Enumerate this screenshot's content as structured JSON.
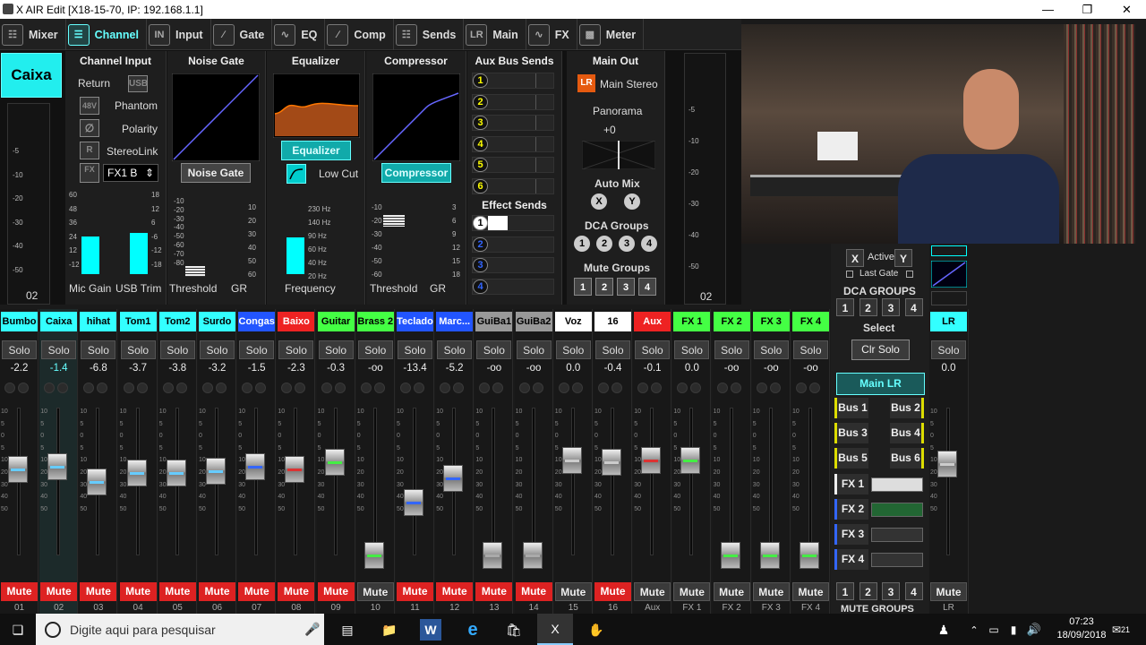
{
  "window": {
    "title": "X AIR Edit [X18-15-70, IP: 192.168.1.1]"
  },
  "nav": {
    "tabs": [
      {
        "label": "Mixer",
        "icon": "mixer-icon"
      },
      {
        "label": "Channel",
        "icon": "channel-icon"
      },
      {
        "label": "Input",
        "icon": "input-icon"
      },
      {
        "label": "Gate",
        "icon": "gate-icon"
      },
      {
        "label": "EQ",
        "icon": "eq-icon"
      },
      {
        "label": "Comp",
        "icon": "comp-icon"
      },
      {
        "label": "Sends",
        "icon": "sends-icon"
      },
      {
        "label": "Main",
        "icon": "main-icon"
      },
      {
        "label": "FX",
        "icon": "fx-icon"
      },
      {
        "label": "Meter",
        "icon": "meter-icon"
      }
    ],
    "active": "Channel"
  },
  "channel": {
    "name": "Caixa",
    "number": "02",
    "input": {
      "title": "Channel Input",
      "return_label": "Return",
      "usb": "USB",
      "phantom_btn": "48V",
      "phantom": "Phantom",
      "polarity": "Polarity",
      "stereolink_btn": "R",
      "stereolink": "StereoLink",
      "fx_btn": "FX",
      "fx_value": "FX1 B",
      "mic_gain": "Mic Gain",
      "usb_trim": "USB Trim",
      "mic_ticks": [
        "60",
        "48",
        "36",
        "24",
        "12",
        "-12"
      ],
      "usb_ticks": [
        "18",
        "12",
        "6",
        "-6",
        "-12",
        "-18"
      ]
    },
    "gate": {
      "title": "Noise Gate",
      "button": "Noise Gate",
      "threshold": "Threshold",
      "gr": "GR",
      "th_ticks": [
        "-10",
        "-20",
        "-30",
        "-40",
        "-50",
        "-60",
        "-70",
        "-80"
      ],
      "gr_ticks": [
        "10",
        "20",
        "30",
        "40",
        "50",
        "60"
      ]
    },
    "eq": {
      "title": "Equalizer",
      "button": "Equalizer",
      "lowcut": "Low Cut",
      "frequency": "Frequency",
      "freq_ticks": [
        "230 Hz",
        "140 Hz",
        "90 Hz",
        "60 Hz",
        "40 Hz",
        "20 Hz"
      ]
    },
    "comp": {
      "title": "Compressor",
      "button": "Compressor",
      "threshold": "Threshold",
      "gr": "GR",
      "th_ticks": [
        "-10",
        "-20",
        "-30",
        "-40",
        "-50",
        "-60"
      ],
      "gr_ticks": [
        "3",
        "6",
        "9",
        "12",
        "15",
        "18"
      ]
    },
    "aux": {
      "title": "Aux Bus Sends",
      "buses": [
        "1",
        "2",
        "3",
        "4",
        "5",
        "6"
      ],
      "effect_title": "Effect Sends",
      "effects": [
        "1",
        "2",
        "3",
        "4"
      ]
    },
    "main": {
      "title": "Main Out",
      "lr": "LR",
      "main_stereo": "Main Stereo",
      "panorama": "Panorama",
      "pan_value": "+0",
      "automix": "Auto Mix",
      "automix_x": "X",
      "automix_y": "Y",
      "dca_title": "DCA Groups",
      "dca": [
        "1",
        "2",
        "3",
        "4"
      ],
      "mute_title": "Mute Groups",
      "mute": [
        "1",
        "2",
        "3",
        "4"
      ]
    },
    "meter_left": {
      "num": "02",
      "ticks": [
        "-5",
        "-10",
        "-20",
        "-30",
        "-40",
        "-50"
      ]
    },
    "meter_right": {
      "num": "02",
      "ticks": [
        "-5",
        "-10",
        "-20",
        "-30",
        "-40",
        "-50"
      ]
    }
  },
  "strips": [
    {
      "name": "Bumbo",
      "color": "#3ff",
      "val": "-2.2",
      "num": "01",
      "mute": "Mute",
      "muted": true,
      "fader": 0.58,
      "stripe": "#6cf"
    },
    {
      "name": "Caixa",
      "color": "#3ff",
      "val": "-1.4",
      "num": "02",
      "mute": "Mute",
      "muted": true,
      "fader": 0.6,
      "stripe": "#6cf"
    },
    {
      "name": "hihat",
      "color": "#3ff",
      "val": "-6.8",
      "num": "03",
      "mute": "Mute",
      "muted": true,
      "fader": 0.5,
      "stripe": "#6cf"
    },
    {
      "name": "Tom1",
      "color": "#3ff",
      "val": "-3.7",
      "num": "04",
      "mute": "Mute",
      "muted": true,
      "fader": 0.56,
      "stripe": "#6cf"
    },
    {
      "name": "Tom2",
      "color": "#3ff",
      "val": "-3.8",
      "num": "05",
      "mute": "Mute",
      "muted": true,
      "fader": 0.56,
      "stripe": "#6cf"
    },
    {
      "name": "Surdo",
      "color": "#3ff",
      "val": "-3.2",
      "num": "06",
      "mute": "Mute",
      "muted": true,
      "fader": 0.57,
      "stripe": "#6cf"
    },
    {
      "name": "Congas",
      "color": "#25f",
      "val": "-1.5",
      "num": "07",
      "mute": "Mute",
      "muted": true,
      "fader": 0.6,
      "stripe": "#36f"
    },
    {
      "name": "Baixo",
      "color": "#e22",
      "val": "-2.3",
      "num": "08",
      "mute": "Mute",
      "muted": true,
      "fader": 0.58,
      "stripe": "#d33"
    },
    {
      "name": "Guitar",
      "color": "#4f4",
      "val": "-0.3",
      "num": "09",
      "mute": "Mute",
      "muted": true,
      "fader": 0.63,
      "stripe": "#4e4"
    },
    {
      "name": "Brass 2",
      "color": "#4f4",
      "val": "-oo",
      "num": "10",
      "mute": "Mute",
      "muted": false,
      "fader": 0.0,
      "stripe": "#4e4"
    },
    {
      "name": "Teclado",
      "color": "#25f",
      "val": "-13.4",
      "num": "11",
      "mute": "Mute",
      "muted": true,
      "fader": 0.36,
      "stripe": "#36f"
    },
    {
      "name": "Marc...",
      "color": "#25f",
      "val": "-5.2",
      "num": "12",
      "mute": "Mute",
      "muted": true,
      "fader": 0.52,
      "stripe": "#36f"
    },
    {
      "name": "GuiBa1",
      "color": "#999",
      "val": "-oo",
      "num": "13",
      "mute": "Mute",
      "muted": true,
      "fader": 0.0,
      "stripe": "#aaa"
    },
    {
      "name": "GuiBa2",
      "color": "#999",
      "val": "-oo",
      "num": "14",
      "mute": "Mute",
      "muted": true,
      "fader": 0.0,
      "stripe": "#aaa"
    },
    {
      "name": "Voz",
      "color": "#fff",
      "val": "0.0",
      "num": "15",
      "mute": "Mute",
      "muted": false,
      "fader": 0.64,
      "stripe": "#ccc"
    },
    {
      "name": "16",
      "color": "#fff",
      "val": "-0.4",
      "num": "16",
      "mute": "Mute",
      "muted": true,
      "fader": 0.63,
      "stripe": "#ccc"
    },
    {
      "name": "Aux",
      "color": "#e22",
      "val": "-0.1",
      "num": "Aux",
      "mute": "Mute",
      "muted": false,
      "fader": 0.64,
      "stripe": "#d33"
    },
    {
      "name": "FX 1",
      "color": "#4f4",
      "val": "0.0",
      "num": "FX 1",
      "mute": "Mute",
      "muted": false,
      "fader": 0.64,
      "stripe": "#4e4"
    },
    {
      "name": "FX 2",
      "color": "#4f4",
      "val": "-oo",
      "num": "FX 2",
      "mute": "Mute",
      "muted": false,
      "fader": 0.0,
      "stripe": "#4e4"
    },
    {
      "name": "FX 3",
      "color": "#4f4",
      "val": "-oo",
      "num": "FX 3",
      "mute": "Mute",
      "muted": false,
      "fader": 0.0,
      "stripe": "#4e4"
    },
    {
      "name": "FX 4",
      "color": "#4f4",
      "val": "-oo",
      "num": "FX 4",
      "mute": "Mute",
      "muted": false,
      "fader": 0.0,
      "stripe": "#4e4"
    }
  ],
  "strip_labels": {
    "solo": "Solo"
  },
  "fader_ticks": [
    "10",
    "5",
    "0",
    "5",
    "10",
    "20",
    "30",
    "40",
    "50"
  ],
  "sidebar": {
    "x": "X",
    "active": "Active",
    "y": "Y",
    "last_gate": "Last Gate",
    "dca_title": "DCA GROUPS",
    "dca": [
      "1",
      "2",
      "3",
      "4"
    ],
    "select": "Select",
    "clr_solo": "Clr Solo",
    "main_lr": "Main LR",
    "buses": [
      "Bus 1",
      "Bus 2",
      "Bus 3",
      "Bus 4",
      "Bus 5",
      "Bus 6"
    ],
    "fx": [
      "FX 1",
      "FX 2",
      "FX 3",
      "FX 4"
    ],
    "mute_groups": [
      "1",
      "2",
      "3",
      "4"
    ],
    "mute_title": "MUTE GROUPS"
  },
  "lr_strip": {
    "name": "LR",
    "solo": "Solo",
    "val": "0.0",
    "mute": "Mute",
    "num": "LR",
    "fader": 0.62
  },
  "taskbar": {
    "search": "Digite aqui para pesquisar",
    "time": "07:23",
    "date": "18/09/2018",
    "notif": "21"
  }
}
